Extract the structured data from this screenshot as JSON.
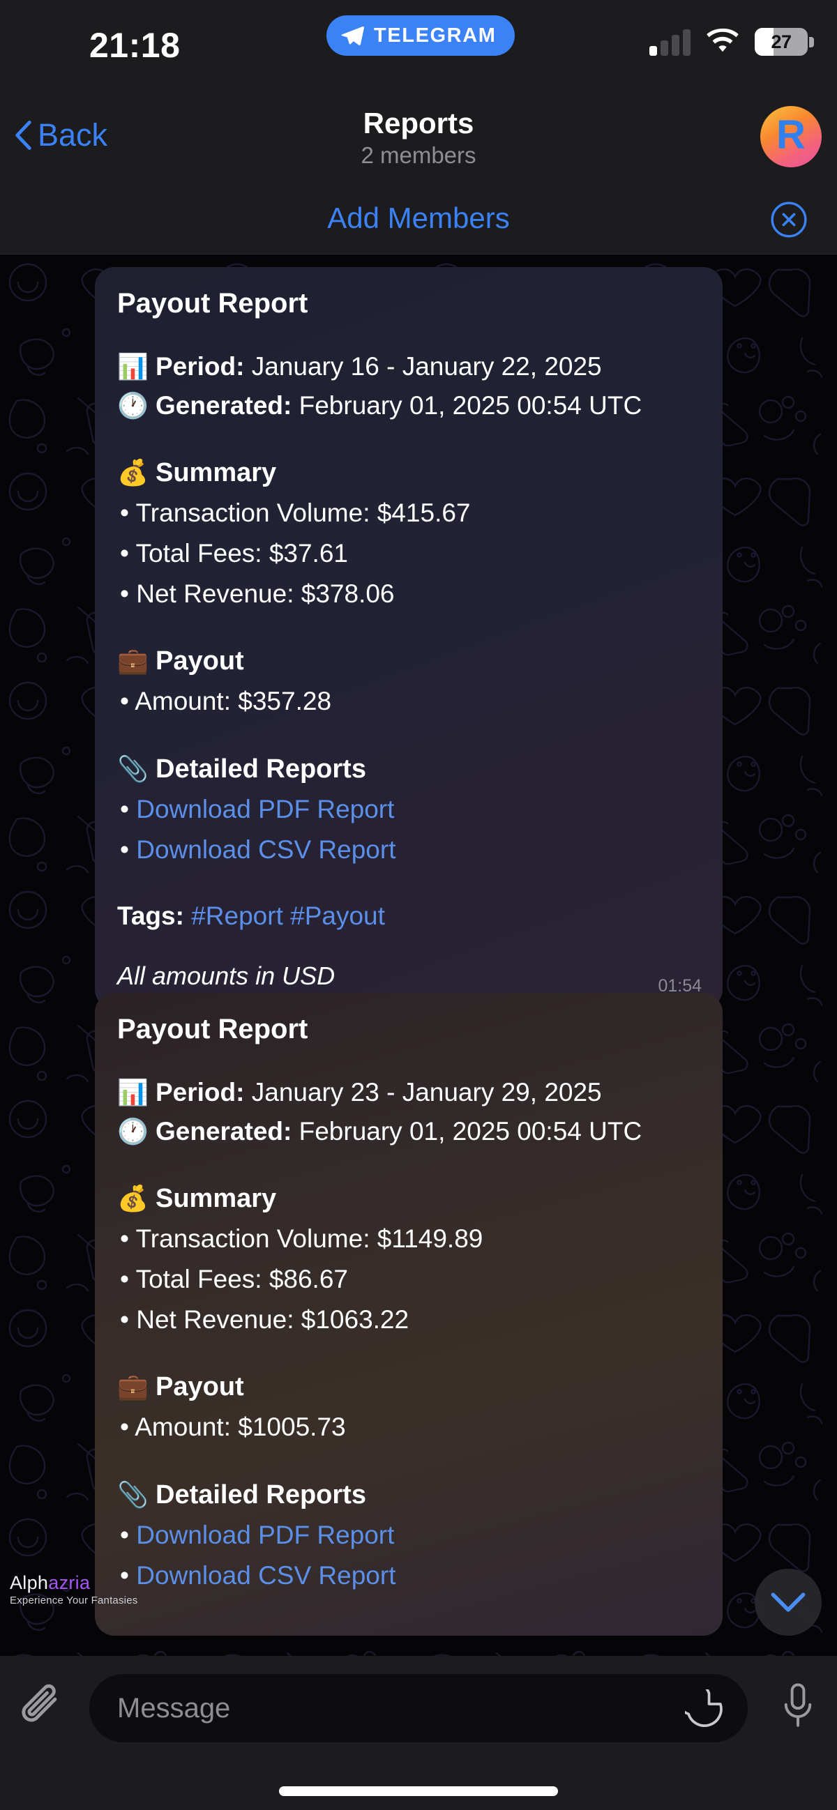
{
  "status_bar": {
    "time": "21:18",
    "app_pill_label": "TELEGRAM",
    "battery_percent": "27",
    "signal_icon": "cellular-signal-icon",
    "wifi_icon": "wifi-icon",
    "battery_icon": "battery-icon"
  },
  "nav": {
    "back_label": "Back",
    "title": "Reports",
    "subtitle": "2 members",
    "avatar_letter": "R"
  },
  "add_members_bar": {
    "label": "Add Members",
    "close_icon": "close-circle-icon"
  },
  "messages": [
    {
      "title": "Payout Report",
      "period_label": "Period:",
      "period_value": "January 16 - January 22, 2025",
      "generated_label": "Generated:",
      "generated_value": "February 01, 2025 00:54 UTC",
      "summary_heading": "Summary",
      "summary_items": [
        "Transaction Volume: $415.67",
        "Total Fees: $37.61",
        "Net Revenue: $378.06"
      ],
      "payout_heading": "Payout",
      "payout_items": [
        "Amount: $357.28"
      ],
      "reports_heading": "Detailed Reports",
      "report_links": [
        "Download PDF Report",
        "Download CSV Report"
      ],
      "tags_label": "Tags:",
      "tags": [
        "#Report",
        "#Payout"
      ],
      "footnote": "All amounts in USD",
      "time": "01:54"
    },
    {
      "title": "Payout Report",
      "period_label": "Period:",
      "period_value": "January 23 - January 29, 2025",
      "generated_label": "Generated:",
      "generated_value": "February 01, 2025 00:54 UTC",
      "summary_heading": "Summary",
      "summary_items": [
        "Transaction Volume: $1149.89",
        "Total Fees: $86.67",
        "Net Revenue: $1063.22"
      ],
      "payout_heading": "Payout",
      "payout_items": [
        "Amount: $1005.73"
      ],
      "reports_heading": "Detailed Reports",
      "report_links": [
        "Download PDF Report",
        "Download CSV Report"
      ]
    }
  ],
  "emoji": {
    "chart": "📊",
    "clock": "🕐",
    "money_bag": "💰",
    "briefcase": "💼",
    "paperclip": "📎"
  },
  "watermark": {
    "brand_first": "Alph",
    "brand_second": "azria",
    "tagline": "Experience Your Fantasies"
  },
  "scroll_button": {
    "icon": "chevron-down-icon"
  },
  "input_bar": {
    "attach_icon": "paperclip-icon",
    "placeholder": "Message",
    "value": "",
    "sticker_icon": "sticker-icon",
    "mic_icon": "microphone-icon"
  },
  "colors": {
    "accent_blue": "#3b82f6",
    "link_blue": "#5b8fe8",
    "bar_background": "#1c1c1e",
    "chat_background": "#050507"
  }
}
